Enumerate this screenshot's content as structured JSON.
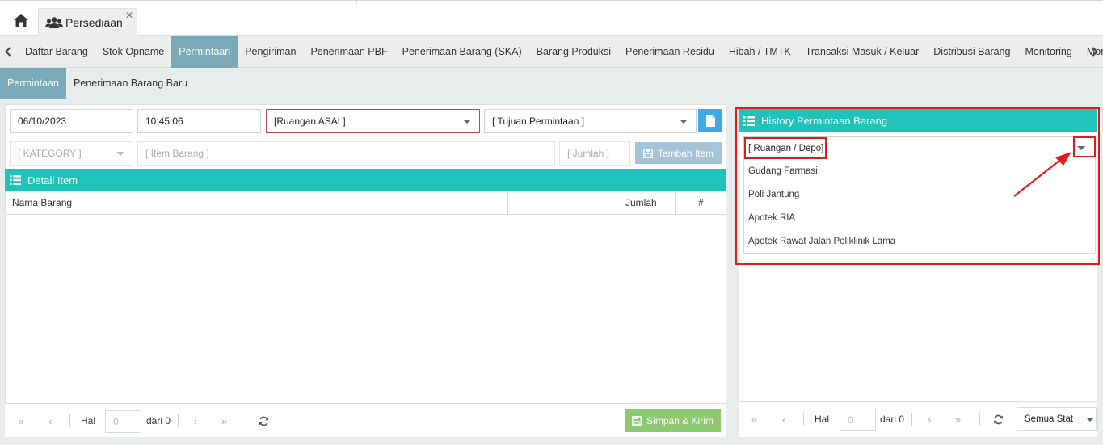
{
  "app_tab": {
    "label": "Persediaan",
    "icon": "users-icon"
  },
  "main_nav": [
    {
      "label": "Daftar Barang",
      "active": false
    },
    {
      "label": "Stok Opname",
      "active": false
    },
    {
      "label": "Permintaan",
      "active": true
    },
    {
      "label": "Pengiriman",
      "active": false
    },
    {
      "label": "Penerimaan PBF",
      "active": false
    },
    {
      "label": "Penerimaan Barang (SKA)",
      "active": false
    },
    {
      "label": "Barang Produksi",
      "active": false
    },
    {
      "label": "Penerimaan Residu",
      "active": false
    },
    {
      "label": "Hibah / TMTK",
      "active": false
    },
    {
      "label": "Transaksi Masuk / Keluar",
      "active": false
    },
    {
      "label": "Distribusi Barang",
      "active": false
    },
    {
      "label": "Monitoring",
      "active": false
    },
    {
      "label": "Moni",
      "active": false
    }
  ],
  "sub_nav": [
    {
      "label": "Permintaan",
      "active": true
    },
    {
      "label": "Penerimaan Barang Baru",
      "active": false
    }
  ],
  "form": {
    "date": "06/10/2023",
    "time": "10:45:06",
    "ruangan_asal": "[Ruangan ASAL]",
    "tujuan": "[ Tujuan Permintaan ]",
    "category": "[ KATEGORY ]",
    "item": "[ Item Barang ]",
    "jumlah": "[ Jumlah ]",
    "tambah_label": "Tambah Item"
  },
  "detail": {
    "title": "Detail Item",
    "columns": [
      "Nama Barang",
      "Jumlah",
      "#"
    ]
  },
  "pager_left": {
    "hal": "Hal",
    "page": "0",
    "dari": "dari 0"
  },
  "save_button": "Simpan & Kirim",
  "history": {
    "title": "History Permintaan Barang",
    "placeholder": "[ Ruangan / Depo]",
    "options": [
      "Gudang Farmasi",
      "Poli Jantung",
      "Apotek RIA",
      "Apotek Rawat Jalan Poliklinik Lama"
    ]
  },
  "pager_right": {
    "hal": "Hal",
    "page": "0",
    "dari": "dari 0",
    "status": "Semua Stat"
  },
  "colors": {
    "teal": "#1fc3b9",
    "nav_active": "#7aaab8",
    "highlight_red": "#e01b1b"
  }
}
